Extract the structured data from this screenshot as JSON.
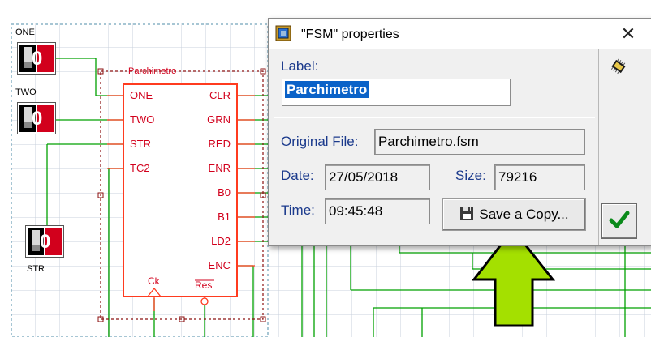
{
  "schematic": {
    "inputs": [
      {
        "name": "ONE",
        "value": "0"
      },
      {
        "name": "TWO",
        "value": "0"
      },
      {
        "name": "STR",
        "value": "0"
      }
    ],
    "block_title": "Parchimetro",
    "left_pins": [
      "ONE",
      "TWO",
      "STR",
      "TC2"
    ],
    "right_pins": [
      "CLR",
      "GRN",
      "RED",
      "ENR",
      "B0",
      "B1",
      "LD2",
      "ENC"
    ],
    "bottom_pins": [
      "Ck",
      "Res"
    ]
  },
  "dialog": {
    "title": "\"FSM\" properties",
    "label_caption": "Label:",
    "label_value": "Parchimetro",
    "original_file_caption": "Original File:",
    "original_file_value": "Parchimetro.fsm",
    "date_caption": "Date:",
    "date_value": "27/05/2018",
    "size_caption": "Size:",
    "size_value": "79216",
    "time_caption": "Time:",
    "time_value": "09:45:48",
    "save_copy_label": "Save a Copy...",
    "close_symbol": "✕"
  },
  "colors": {
    "grid": "#c8d0dc",
    "wire": "#00a000",
    "block": "#ff3b1f",
    "dash": "#8b1010",
    "arrow": "#a4e000",
    "selection": "#0a62c8",
    "label": "#1b3a8c"
  },
  "icons": {
    "fsm_title_icon": "fsm-chip-icon",
    "close": "close-icon",
    "floppy": "floppy-disk-icon",
    "ok": "checkmark-icon",
    "arrow": "up-arrow-icon"
  }
}
